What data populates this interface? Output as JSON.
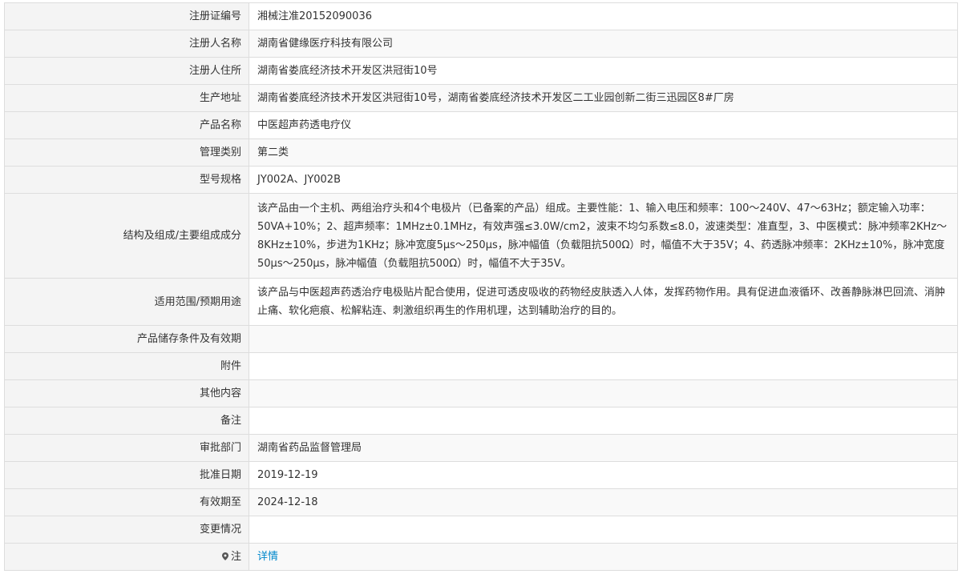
{
  "rows": [
    {
      "label": "注册证编号",
      "value": "湘械注准20152090036"
    },
    {
      "label": "注册人名称",
      "value": "湖南省健缘医疗科技有限公司"
    },
    {
      "label": "注册人住所",
      "value": "湖南省娄底经济技术开发区洪冠街10号"
    },
    {
      "label": "生产地址",
      "value": "湖南省娄底经济技术开发区洪冠街10号，湖南省娄底经济技术开发区二工业园创新二街三迅园区8#厂房"
    },
    {
      "label": "产品名称",
      "value": "中医超声药透电疗仪"
    },
    {
      "label": "管理类别",
      "value": "第二类"
    },
    {
      "label": "型号规格",
      "value": "JY002A、JY002B"
    },
    {
      "label": "结构及组成/主要组成成分",
      "value": "该产品由一个主机、两组治疗头和4个电极片（已备案的产品）组成。主要性能：1、输入电压和频率：100～240V、47～63Hz；额定输入功率：50VA+10%；2、超声频率：1MHz±0.1MHz，有效声强≤3.0W/cm2，波束不均匀系数≤8.0，波速类型：准直型，3、中医模式：脉冲频率2KHz～8KHz±10%，步进为1KHz；脉冲宽度5μs～250μs，脉冲幅值（负载阻抗500Ω）时，幅值不大于35V；4、药透脉冲频率：2KHz±10%，脉冲宽度50μs～250μs，脉冲幅值（负载阻抗500Ω）时，幅值不大于35V。"
    },
    {
      "label": "适用范围/预期用途",
      "value": "该产品与中医超声药透治疗电极贴片配合使用，促进可透皮吸收的药物经皮肤透入人体，发挥药物作用。具有促进血液循环、改善静脉淋巴回流、消肿止痛、软化疤痕、松解粘连、刺激组织再生的作用机理，达到辅助治疗的目的。"
    },
    {
      "label": "产品储存条件及有效期",
      "value": ""
    },
    {
      "label": "附件",
      "value": ""
    },
    {
      "label": "其他内容",
      "value": ""
    },
    {
      "label": "备注",
      "value": ""
    },
    {
      "label": "审批部门",
      "value": "湖南省药品监督管理局"
    },
    {
      "label": "批准日期",
      "value": "2019-12-19"
    },
    {
      "label": "有效期至",
      "value": "2024-12-18"
    },
    {
      "label": "变更情况",
      "value": ""
    }
  ],
  "note": {
    "label": "注",
    "icon": "location-pin-icon",
    "link_text": "详情",
    "link_color": "#0088cc"
  }
}
